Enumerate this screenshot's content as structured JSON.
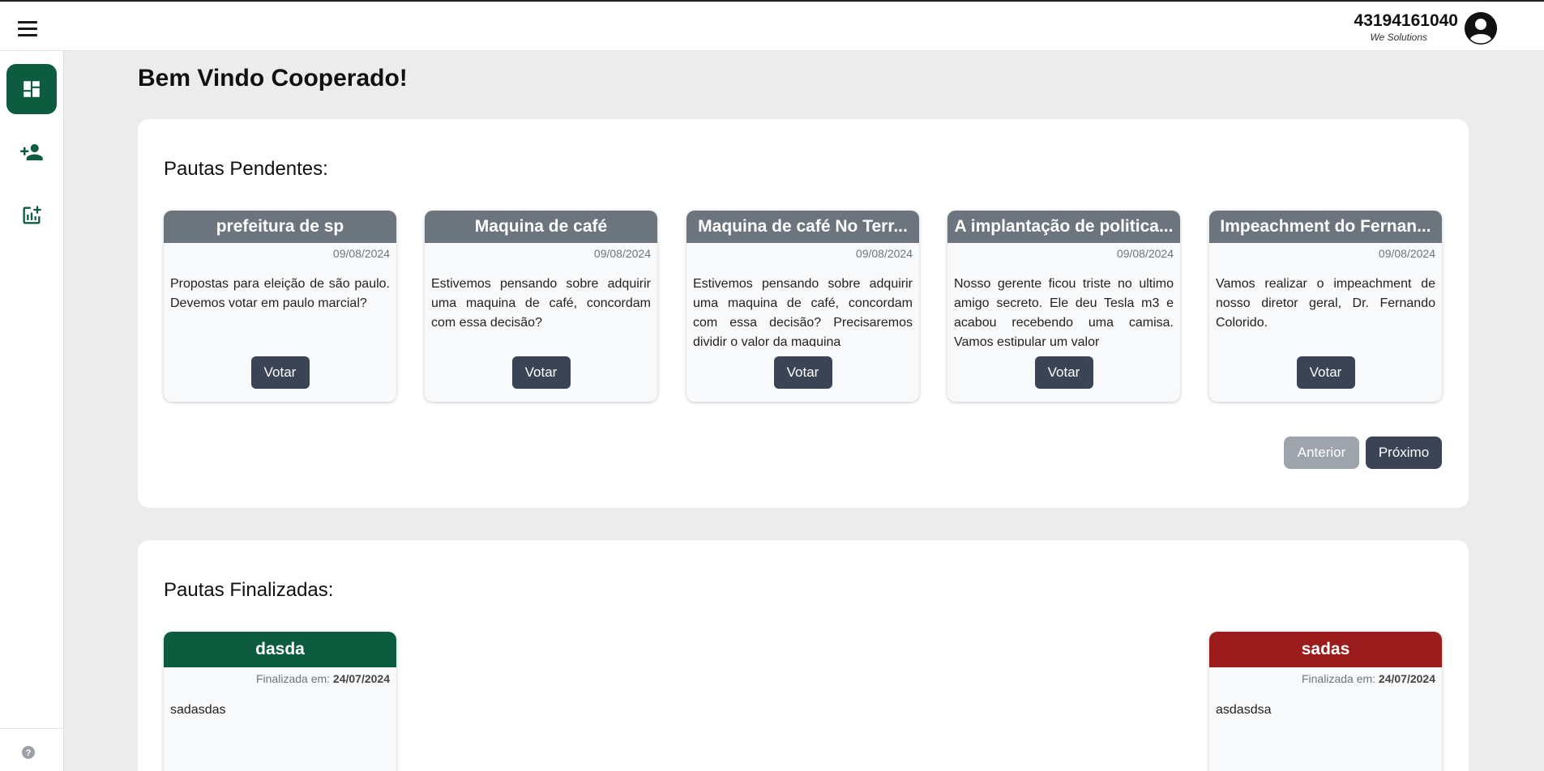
{
  "header": {
    "user_id": "43194161040",
    "company": "We Solutions",
    "icons": {
      "menu": "hamburger-menu-icon",
      "avatar": "account-circle-icon"
    }
  },
  "sidebar": {
    "items": [
      {
        "icon": "dashboard-icon",
        "active": true
      },
      {
        "icon": "person-add-icon",
        "active": false
      },
      {
        "icon": "add-chart-icon",
        "active": false
      }
    ],
    "help_icon": "help-icon"
  },
  "main": {
    "welcome": "Bem Vindo Cooperado!",
    "pending": {
      "title": "Pautas Pendentes:",
      "cards": [
        {
          "title": "prefeitura de sp",
          "date": "09/08/2024",
          "description": "Propostas para eleição de são paulo. Devemos votar em paulo marcial?",
          "button": "Votar"
        },
        {
          "title": "Maquina de café",
          "date": "09/08/2024",
          "description": "Estivemos pensando sobre adquirir uma maquina de café, concordam com essa decisão?",
          "button": "Votar"
        },
        {
          "title": "Maquina de café No Terr...",
          "date": "09/08/2024",
          "description": "Estivemos pensando sobre adquirir uma maquina de café, concordam com essa decisão? Precisaremos dividir o valor da maquina",
          "button": "Votar"
        },
        {
          "title": "A implantação de politica...",
          "date": "09/08/2024",
          "description": "Nosso gerente ficou triste no ultimo amigo secreto. Ele deu Tesla m3 e acabou recebendo uma camisa. Vamos estipular um valor",
          "button": "Votar"
        },
        {
          "title": "Impeachment do Fernan...",
          "date": "09/08/2024",
          "description": "Vamos realizar o impeachment de nosso diretor geral, Dr. Fernando Colorido.",
          "button": "Votar"
        }
      ],
      "prev_label": "Anterior",
      "next_label": "Próximo"
    },
    "finished": {
      "title": "Pautas Finalizadas:",
      "date_prefix": "Finalizada em:",
      "cards": [
        {
          "title": "dasda",
          "date": "24/07/2024",
          "description": "sadasdas",
          "color": "#0d5c40"
        },
        {
          "title": "sadas",
          "date": "24/07/2024",
          "description": "asdasdsa",
          "color": "#9b1c1c"
        }
      ]
    }
  },
  "colors": {
    "brand_green": "#0d5c40",
    "card_header_gray": "#6c757d",
    "button_dark": "#3a4454",
    "button_disabled": "#9ea4ab",
    "rejected_red": "#9b1c1c"
  }
}
